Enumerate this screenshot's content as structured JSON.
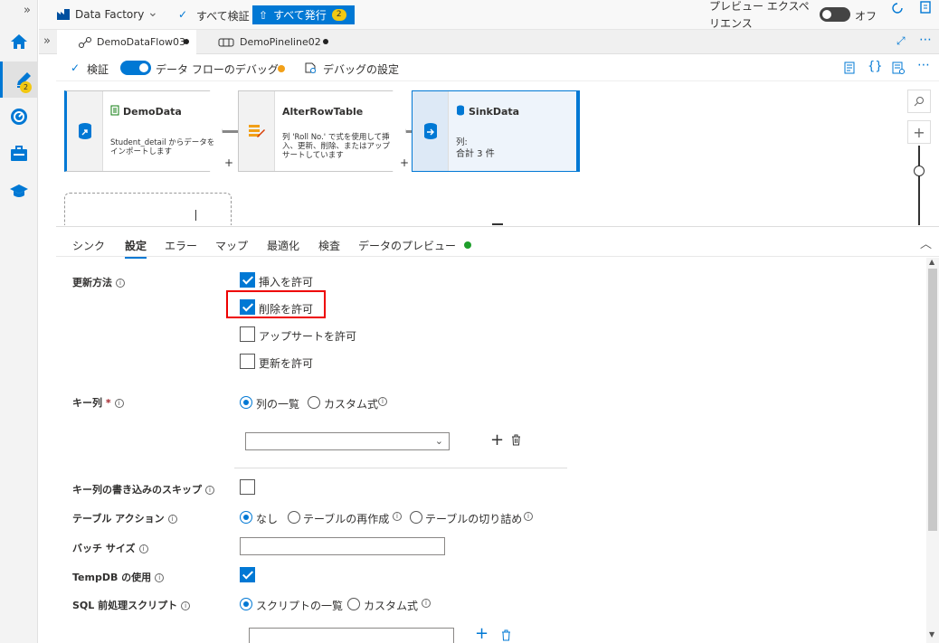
{
  "topbar": {
    "factory_name": "Data Factory",
    "validate_all": "すべて検証",
    "publish_all": "すべて発行",
    "publish_count": "2",
    "preview_experience": "プレビュー エクスペ\nリエンス",
    "preview_experience_line1": "プレビュー エクスペ",
    "preview_experience_line2": "リエンス",
    "toggle_state": "オフ"
  },
  "rail": {
    "author_badge": "2"
  },
  "tabs": [
    {
      "label": "DemoDataFlow03",
      "active": true,
      "unsaved": true
    },
    {
      "label": "DemoPineline02",
      "active": false,
      "unsaved": true
    }
  ],
  "toolbar": {
    "validate": "検証",
    "debug": "データ フローのデバッグ",
    "debug_settings": "デバッグの設定"
  },
  "nodes": [
    {
      "title": "DemoData",
      "desc": "Student_detail\nからデータをインポートします"
    },
    {
      "title": "AlterRowTable",
      "desc": "列 'Roll No.'\nで式を使用して挿入、更新、削除、またはアップサートしています"
    },
    {
      "title": "SinkData",
      "desc_line1": "列:",
      "desc_line2": "合計 3 件"
    }
  ],
  "panel_tabs": [
    "シンク",
    "設定",
    "エラー",
    "マップ",
    "最適化",
    "検査",
    "データのプレビュー"
  ],
  "form": {
    "update_method_label": "更新方法",
    "update_options": [
      {
        "label": "挿入を許可",
        "checked": true
      },
      {
        "label": "削除を許可",
        "checked": true
      },
      {
        "label": "アップサートを許可",
        "checked": false
      },
      {
        "label": "更新を許可",
        "checked": false
      }
    ],
    "key_columns_label": "キー列",
    "key_columns_required": "*",
    "key_options": [
      "列の一覧",
      "カスタム式"
    ],
    "skip_key_write_label": "キー列の書き込みのスキップ",
    "table_action_label": "テーブル アクション",
    "table_action_options": [
      "なし",
      "テーブルの再作成",
      "テーブルの切り詰め"
    ],
    "batch_size_label": "バッチ サイズ",
    "batch_size_value": "",
    "tempdb_label": "TempDB の使用",
    "tempdb_checked": true,
    "sql_pre_label": "SQL 前処理スクリプト",
    "sql_pre_options": [
      "スクリプトの一覧",
      "カスタム式"
    ]
  },
  "colors": {
    "accent": "#0078d4",
    "highlight": "#e00000",
    "badge": "#f2c811",
    "preview_dot": "#1e9e2b"
  }
}
